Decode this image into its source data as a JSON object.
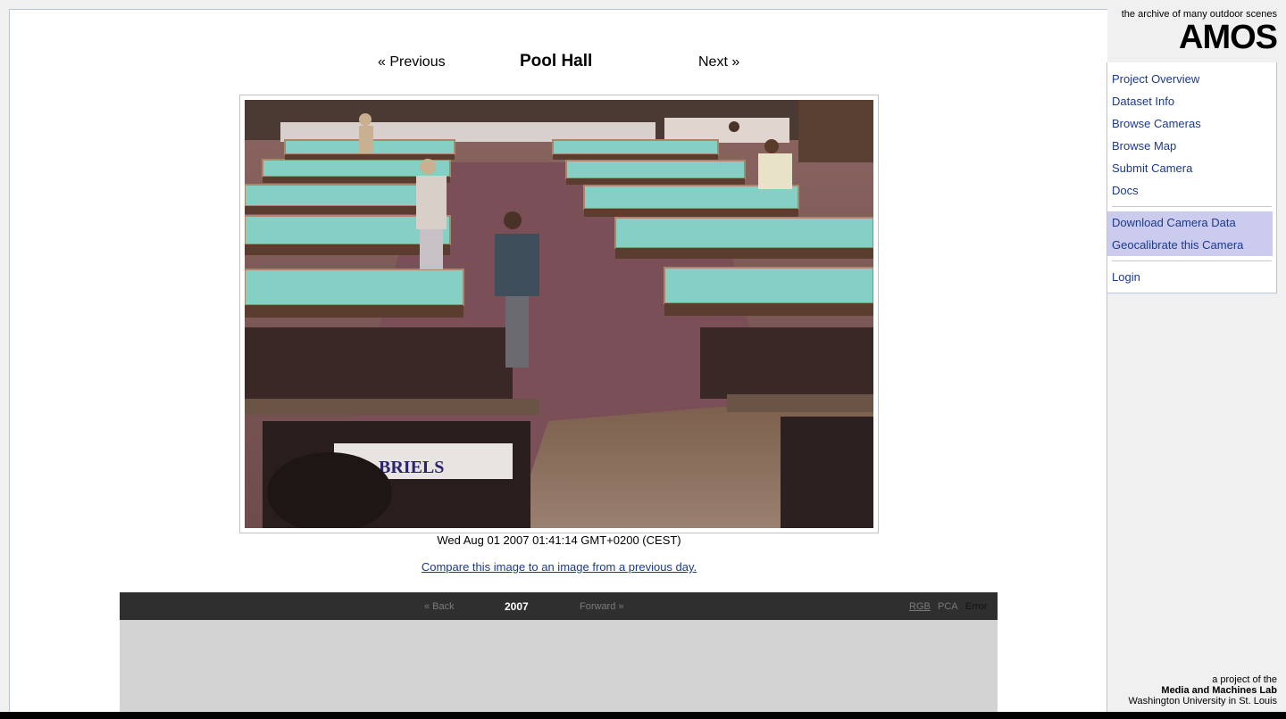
{
  "nav": {
    "prev_label": "« Previous",
    "title": "Pool Hall",
    "next_label": "Next »"
  },
  "camera": {
    "timestamp": "Wed Aug 01 2007 01:41:14 GMT+0200 (CEST)",
    "compare_link": "Compare this image to an image from a previous day.",
    "image_overlay_text": "BRIELS"
  },
  "timeline": {
    "back_label": "« Back",
    "year": "2007",
    "forward_label": "Forward »",
    "modes": [
      "RGB",
      "PCA",
      "Error"
    ],
    "active_mode": "Error"
  },
  "brand": {
    "tagline": "the archive of many outdoor scenes",
    "logo": "AMOS"
  },
  "menu": {
    "items": [
      "Project Overview",
      "Dataset Info",
      "Browse Cameras",
      "Browse Map",
      "Submit Camera",
      "Docs"
    ],
    "camera_items": [
      "Download Camera Data",
      "Geocalibrate this Camera"
    ],
    "login": "Login"
  },
  "credit": {
    "line1": "a project of the",
    "lab": "Media and Machines Lab",
    "university": "Washington University in St. Louis"
  },
  "colors": {
    "link": "#1c3a8a",
    "highlight": "#cbcbee",
    "timeline_bar": "#2f2f2f",
    "timeline_bg": "#d3d3d3",
    "table_felt": "#7fd0c6"
  }
}
